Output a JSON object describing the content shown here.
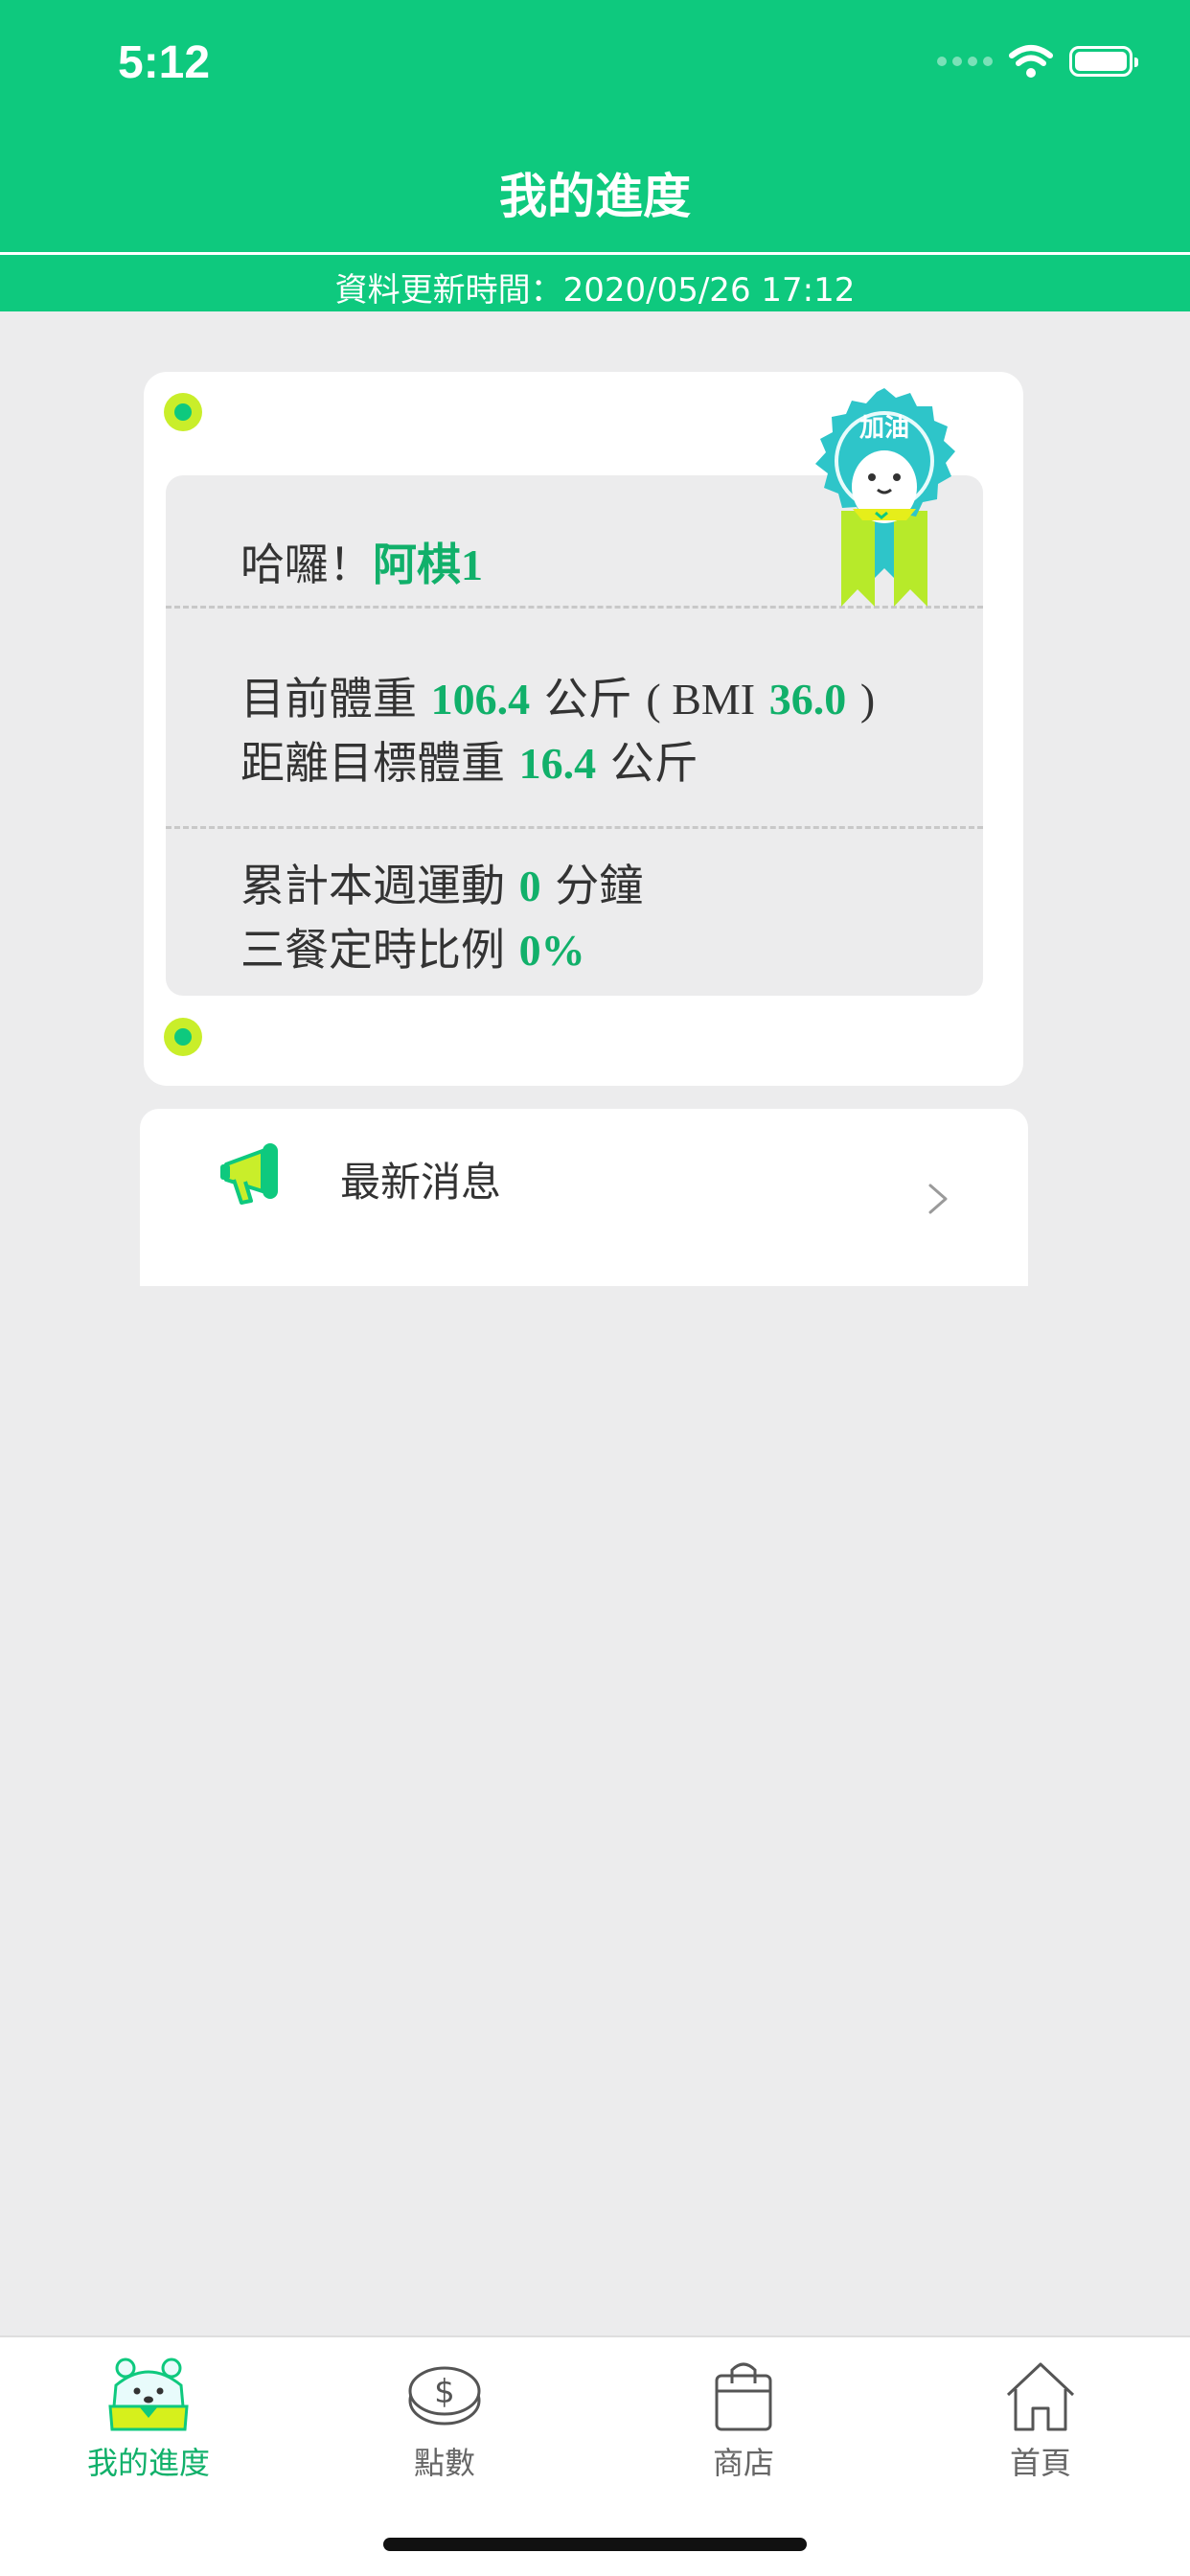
{
  "status_bar": {
    "time": "5:12"
  },
  "header": {
    "title": "我的進度",
    "update_text": "資料更新時間：2020/05/26 17:12"
  },
  "progress_card": {
    "badge_text": "加油",
    "greeting_prefix": "哈囉！",
    "user_name": "阿棋1",
    "weight_label": "目前體重",
    "weight_value": "106.4",
    "weight_unit": "公斤",
    "bmi_open": "( BMI",
    "bmi_value": "36.0",
    "bmi_close": ")",
    "target_label": "距離目標體重",
    "target_value": "16.4",
    "target_unit": "公斤",
    "exercise_label": "累計本週運動",
    "exercise_value": "0",
    "exercise_unit": "分鐘",
    "meal_label": "三餐定時比例",
    "meal_value": "0%"
  },
  "news": {
    "label": "最新消息"
  },
  "tabbar": {
    "items": [
      {
        "label": "我的進度",
        "icon": "bear-icon",
        "active": true
      },
      {
        "label": "點數",
        "icon": "coin-icon",
        "active": false
      },
      {
        "label": "商店",
        "icon": "shopping-bag-icon",
        "active": false
      },
      {
        "label": "首頁",
        "icon": "home-icon",
        "active": false
      }
    ]
  },
  "colors": {
    "brand_green": "#0ec97e",
    "highlight_green": "#11b06a",
    "accent_lime": "#c9ee2a",
    "background": "#ececed"
  }
}
